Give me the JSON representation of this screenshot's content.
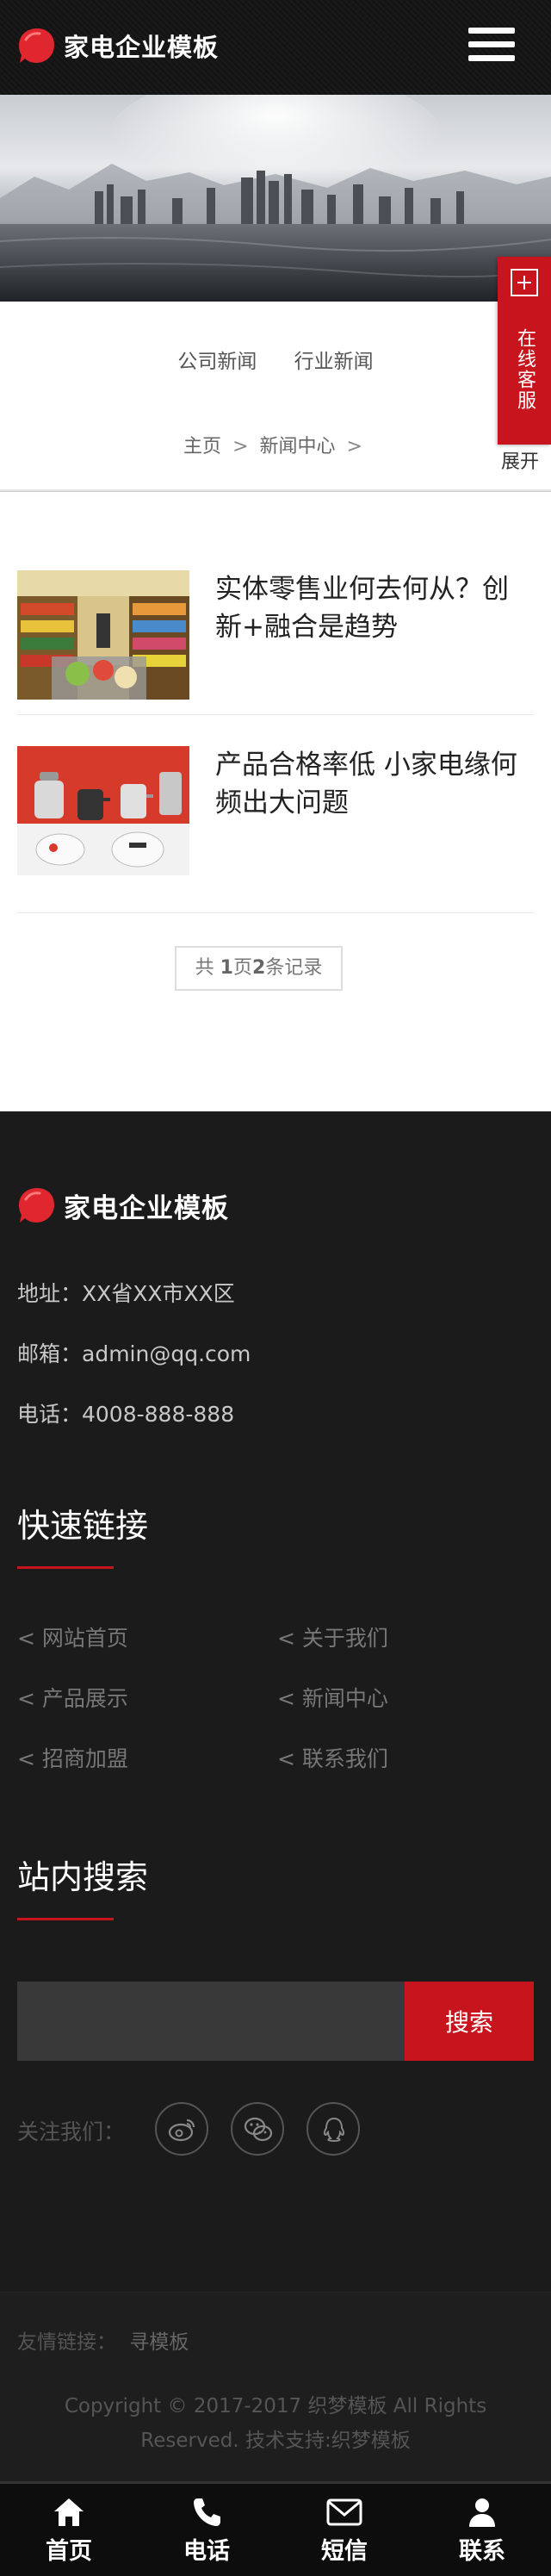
{
  "header": {
    "logo_text": "家电企业模板"
  },
  "side_float": {
    "label": "在线客服",
    "expand": "展开"
  },
  "subnav": {
    "items": [
      "公司新闻",
      "行业新闻"
    ]
  },
  "breadcrumb": {
    "home": "主页",
    "sep": ">",
    "current": "新闻中心"
  },
  "news": {
    "items": [
      {
        "title": "实体零售业何去何从？创新+融合是趋势"
      },
      {
        "title": "产品合格率低 小家电缘何频出大问题"
      }
    ]
  },
  "pager": {
    "prefix": "共",
    "pages": "1",
    "pages_unit": "页",
    "records": "2",
    "records_unit": "条记录"
  },
  "footer": {
    "logo_text": "家电企业模板",
    "address": "地址：XX省XX市XX区",
    "email": "邮箱：admin@qq.com",
    "phone": "电话：4008-888-888",
    "quick_links_title": "快速链接",
    "quick_links": [
      "< 网站首页",
      "< 关于我们",
      "< 产品展示",
      "< 新闻中心",
      "< 招商加盟",
      "< 联系我们"
    ],
    "search_title": "站内搜索",
    "search_value": "",
    "search_button": "搜索",
    "follow_label": "关注我们：",
    "friend_label": "友情链接：",
    "friend_link": "寻模板",
    "copyright_line1": "Copyright © 2017-2017 织梦模板 All Rights",
    "copyright_line2": "Reserved.   技术支持:织梦模板"
  },
  "tabbar": {
    "items": [
      "首页",
      "电话",
      "短信",
      "联系"
    ]
  },
  "colors": {
    "accent": "#c8141d",
    "footer_bg": "#1b1b1b",
    "header_bg": "#141414"
  }
}
